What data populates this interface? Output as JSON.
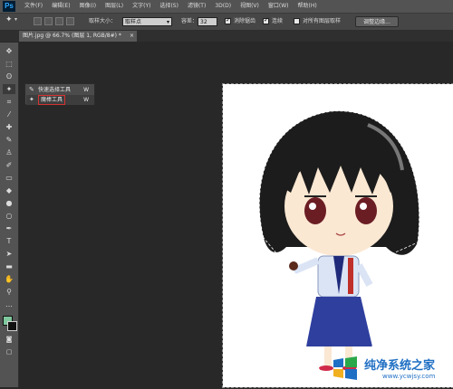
{
  "app": {
    "logo": "Ps"
  },
  "menu": [
    "文件(F)",
    "编辑(E)",
    "图像(I)",
    "图层(L)",
    "文字(Y)",
    "选择(S)",
    "滤镜(T)",
    "3D(D)",
    "视图(V)",
    "窗口(W)",
    "帮助(H)"
  ],
  "options": {
    "sample_size_label": "取样大小：",
    "sample_size_value": "取样点",
    "tolerance_label": "容差：",
    "tolerance_value": "32",
    "antialias_label": "消除锯齿",
    "antialias_checked": true,
    "contiguous_label": "连续",
    "contiguous_checked": true,
    "sample_all_label": "对所有图层取样",
    "sample_all_checked": false,
    "refine_edge_label": "调整边缘..."
  },
  "document_tab": {
    "title": "图片.jpg @ 66.7% (图层 1, RGB/8#) *",
    "close": "×"
  },
  "tool_flyout": {
    "items": [
      {
        "icon": "quick-selection-icon",
        "label": "快速选择工具",
        "shortcut": "W"
      },
      {
        "icon": "magic-wand-icon",
        "label": "魔棒工具",
        "shortcut": "W",
        "highlighted": true
      }
    ]
  },
  "colors": {
    "foreground": "#7fc89e",
    "background": "#111111",
    "highlight_border": "#d63232"
  },
  "watermark": {
    "title": "纯净系统之家",
    "url": "www.ycwjsy.com"
  }
}
